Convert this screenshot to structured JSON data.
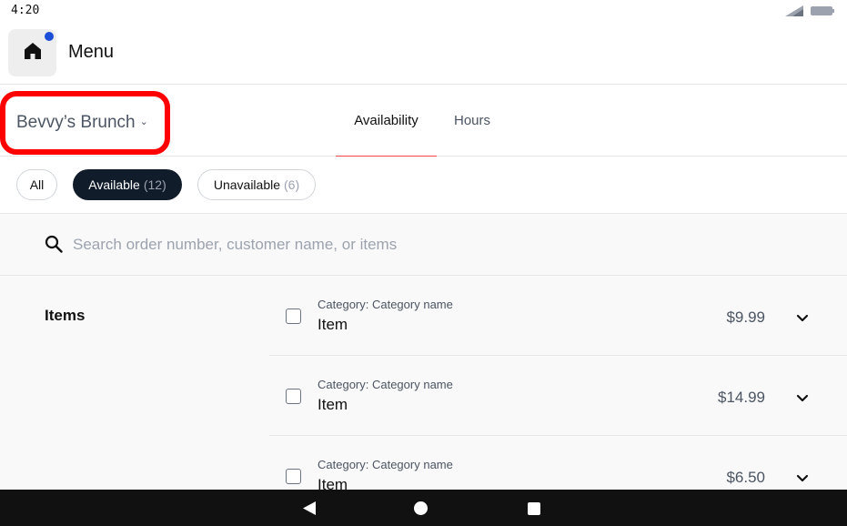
{
  "status_bar": {
    "time": "4:20"
  },
  "header": {
    "title": "Menu"
  },
  "store_selector": {
    "name": "Bevvy’s Brunch",
    "chevron": "⌄"
  },
  "tabs": [
    {
      "label": "Availability",
      "active": true
    },
    {
      "label": "Hours",
      "active": false
    }
  ],
  "filters": {
    "all": {
      "label": "All"
    },
    "available": {
      "label": "Available",
      "count": "(12)"
    },
    "unavailable": {
      "label": "Unavailable",
      "count": "(6)"
    }
  },
  "search": {
    "placeholder": "Search order number, customer name, or items"
  },
  "section": {
    "label": "Items"
  },
  "items": [
    {
      "category": "Category: Category name",
      "name": "Item",
      "price": "$9.99"
    },
    {
      "category": "Category: Category name",
      "name": "Item",
      "price": "$14.99"
    },
    {
      "category": "Category: Category name",
      "name": "Item",
      "price": "$6.50"
    }
  ],
  "colors": {
    "accent_tab_underline": "#ef4444",
    "highlight_box": "#ff0000",
    "chip_active_bg": "#111c2b",
    "notification_dot": "#1d4ed8"
  },
  "icons": [
    "home-icon",
    "search-icon",
    "chevron-down-icon",
    "signal-icon",
    "battery-icon",
    "back-icon",
    "home-circle-icon",
    "recents-icon"
  ]
}
